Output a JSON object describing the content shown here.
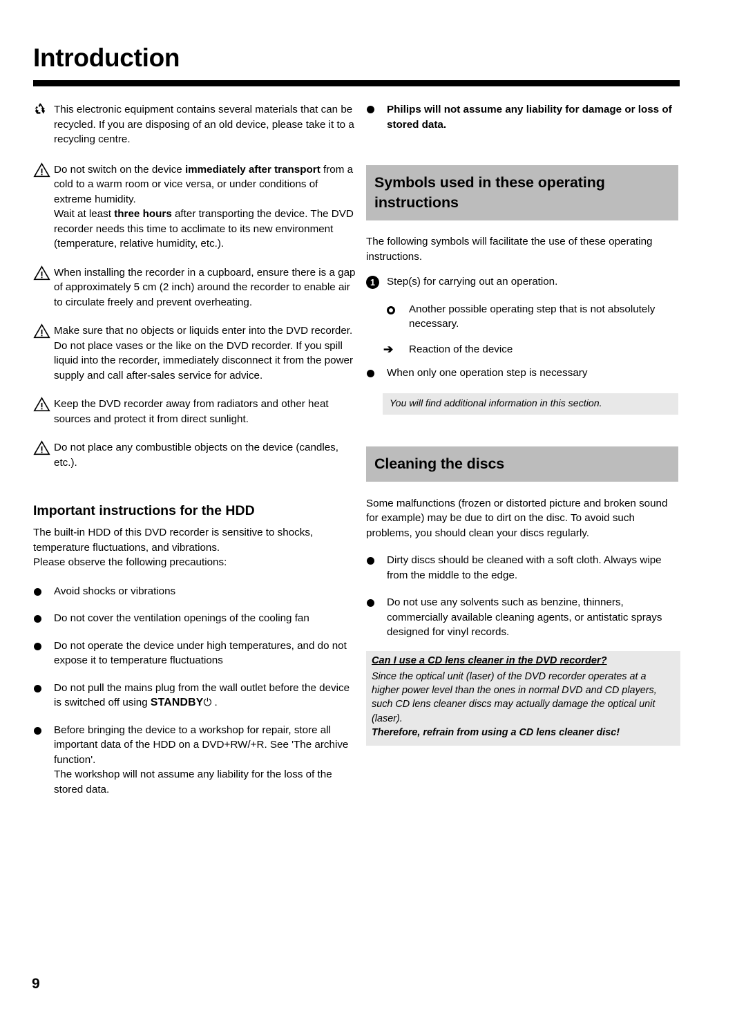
{
  "document": {
    "chapter_title": "Introduction",
    "folio": "9"
  },
  "left_column": {
    "items": [
      {
        "icon": "recycle-icon",
        "text": "This electronic equipment contains several materials that can be recycled. If you are disposing of an old device, please take it to a recycling centre."
      },
      {
        "icon": "warning-triangle-icon",
        "text_lead": "Do not switch on the device ",
        "text_bold": "immediately after transport",
        "text_tail": " from a cold to a warm room or vice versa, or under conditions of extreme humidity.",
        "text_line2_lead": "Wait at least ",
        "text_line2_bold": "three hours",
        "text_line2_tail": " after transporting the device. The DVD recorder needs this time to acclimate to its new environment (temperature, relative humidity, etc.)."
      },
      {
        "icon": "warning-triangle-icon",
        "text": "When installing the recorder in a cupboard, ensure there is a gap of approximately 5 cm (2 inch) around the recorder to enable air to circulate freely and prevent overheating."
      },
      {
        "icon": "warning-triangle-icon",
        "text": "Make sure that no objects or liquids enter into the DVD recorder. Do not place vases or the like on the DVD recorder. If you spill liquid into the recorder, immediately disconnect it from the power supply and call after-sales service for advice."
      },
      {
        "icon": "warning-triangle-icon",
        "text": "Keep the DVD recorder away from radiators and other heat sources and protect it from direct sunlight."
      },
      {
        "icon": "warning-triangle-icon",
        "text": "Do not place any combustible objects on the device (candles, etc.)."
      }
    ],
    "hdd_section": {
      "heading": "Important instructions for the HDD",
      "intro_line1": "The built-in HDD of this DVD recorder is sensitive to shocks,",
      "intro_line2": "temperature fluctuations, and vibrations.",
      "intro_line3": "Please observe the following precautions:",
      "bullets": [
        {
          "icon": "bullet-dot-icon",
          "text": "Avoid shocks or vibrations"
        },
        {
          "icon": "bullet-dot-icon",
          "text": "Do not cover the ventilation openings of the cooling fan"
        },
        {
          "icon": "bullet-dot-icon",
          "text": "Do not operate the device under high temperatures, and do not expose it to temperature fluctuations"
        },
        {
          "icon": "bullet-dot-icon",
          "text_lead": "Do not pull the mains plug from the wall outlet before the device is switched off using ",
          "text_button": "STANDBY",
          "text_symbol": "⏻",
          "text_tail": " ."
        },
        {
          "icon": "bullet-dot-icon",
          "text": "Before bringing the device to a workshop for repair, store all important data of the HDD on a DVD+RW/+R. See 'The archive function'.",
          "text_second": "The workshop will not assume any liability for the loss of the stored data."
        }
      ]
    }
  },
  "right_column": {
    "top_bullet": {
      "icon": "bullet-dot-icon",
      "text": "Philips will not assume any liability for damage or loss of stored data."
    },
    "symbols_section": {
      "heading": "Symbols used in these operating instructions",
      "intro": "The following symbols will facilitate the use of these operating instructions.",
      "entries": [
        {
          "icon": "numbered-circle-icon",
          "marker": "1",
          "text": "Step(s) for carrying out an operation."
        },
        {
          "icon": "hollow-bullet-icon",
          "marker": "",
          "text": "Another possible operating step that is not absolutely necessary."
        },
        {
          "icon": "arrow-right-icon",
          "marker": "➔",
          "text": "Reaction of the device"
        },
        {
          "icon": "bullet-dot-icon",
          "marker": "",
          "text": "When only one operation step is necessary"
        }
      ],
      "note": "You will find additional information in this section."
    },
    "cleaning_section": {
      "heading": "Cleaning the discs",
      "intro": "Some malfunctions (frozen or distorted picture and broken sound for example) may be due to dirt on the disc. To avoid such problems, you should clean your discs regularly.",
      "bullets": [
        {
          "icon": "bullet-dot-icon",
          "text": "Dirty discs should be cleaned with a soft cloth. Always wipe from the middle to the edge."
        },
        {
          "icon": "bullet-dot-icon",
          "text": "Do not use any solvents such as benzine, thinners, commercially available cleaning agents, or antistatic sprays designed for vinyl records."
        }
      ],
      "qa": {
        "question": "Can I use a CD lens cleaner in the DVD recorder?",
        "answer": "Since the optical unit (laser) of the DVD recorder operates at a higher power level than the ones in normal DVD and CD players, such CD lens cleaner discs may actually damage the optical unit (laser).",
        "answer_bold": "Therefore, refrain from using a CD lens cleaner disc!"
      }
    }
  },
  "colors": {
    "heading_band": "#bcbcbc",
    "note_box": "#e8e8e8",
    "rule": "#000000"
  }
}
